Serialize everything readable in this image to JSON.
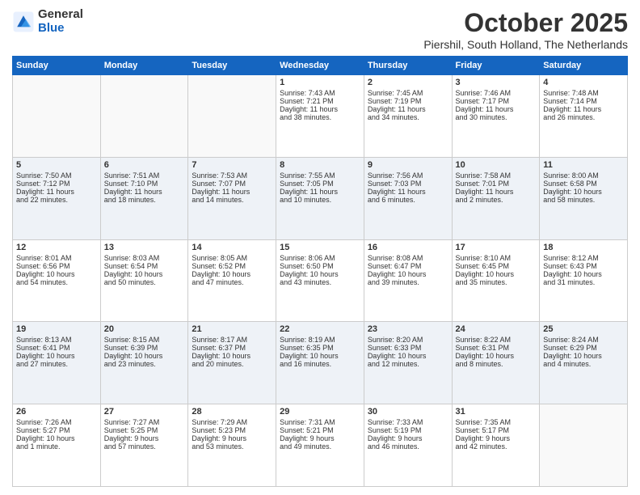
{
  "logo": {
    "general": "General",
    "blue": "Blue"
  },
  "header": {
    "month": "October 2025",
    "location": "Piershil, South Holland, The Netherlands"
  },
  "weekdays": [
    "Sunday",
    "Monday",
    "Tuesday",
    "Wednesday",
    "Thursday",
    "Friday",
    "Saturday"
  ],
  "weeks": [
    [
      {
        "day": "",
        "info": ""
      },
      {
        "day": "",
        "info": ""
      },
      {
        "day": "",
        "info": ""
      },
      {
        "day": "1",
        "info": "Sunrise: 7:43 AM\nSunset: 7:21 PM\nDaylight: 11 hours\nand 38 minutes."
      },
      {
        "day": "2",
        "info": "Sunrise: 7:45 AM\nSunset: 7:19 PM\nDaylight: 11 hours\nand 34 minutes."
      },
      {
        "day": "3",
        "info": "Sunrise: 7:46 AM\nSunset: 7:17 PM\nDaylight: 11 hours\nand 30 minutes."
      },
      {
        "day": "4",
        "info": "Sunrise: 7:48 AM\nSunset: 7:14 PM\nDaylight: 11 hours\nand 26 minutes."
      }
    ],
    [
      {
        "day": "5",
        "info": "Sunrise: 7:50 AM\nSunset: 7:12 PM\nDaylight: 11 hours\nand 22 minutes."
      },
      {
        "day": "6",
        "info": "Sunrise: 7:51 AM\nSunset: 7:10 PM\nDaylight: 11 hours\nand 18 minutes."
      },
      {
        "day": "7",
        "info": "Sunrise: 7:53 AM\nSunset: 7:07 PM\nDaylight: 11 hours\nand 14 minutes."
      },
      {
        "day": "8",
        "info": "Sunrise: 7:55 AM\nSunset: 7:05 PM\nDaylight: 11 hours\nand 10 minutes."
      },
      {
        "day": "9",
        "info": "Sunrise: 7:56 AM\nSunset: 7:03 PM\nDaylight: 11 hours\nand 6 minutes."
      },
      {
        "day": "10",
        "info": "Sunrise: 7:58 AM\nSunset: 7:01 PM\nDaylight: 11 hours\nand 2 minutes."
      },
      {
        "day": "11",
        "info": "Sunrise: 8:00 AM\nSunset: 6:58 PM\nDaylight: 10 hours\nand 58 minutes."
      }
    ],
    [
      {
        "day": "12",
        "info": "Sunrise: 8:01 AM\nSunset: 6:56 PM\nDaylight: 10 hours\nand 54 minutes."
      },
      {
        "day": "13",
        "info": "Sunrise: 8:03 AM\nSunset: 6:54 PM\nDaylight: 10 hours\nand 50 minutes."
      },
      {
        "day": "14",
        "info": "Sunrise: 8:05 AM\nSunset: 6:52 PM\nDaylight: 10 hours\nand 47 minutes."
      },
      {
        "day": "15",
        "info": "Sunrise: 8:06 AM\nSunset: 6:50 PM\nDaylight: 10 hours\nand 43 minutes."
      },
      {
        "day": "16",
        "info": "Sunrise: 8:08 AM\nSunset: 6:47 PM\nDaylight: 10 hours\nand 39 minutes."
      },
      {
        "day": "17",
        "info": "Sunrise: 8:10 AM\nSunset: 6:45 PM\nDaylight: 10 hours\nand 35 minutes."
      },
      {
        "day": "18",
        "info": "Sunrise: 8:12 AM\nSunset: 6:43 PM\nDaylight: 10 hours\nand 31 minutes."
      }
    ],
    [
      {
        "day": "19",
        "info": "Sunrise: 8:13 AM\nSunset: 6:41 PM\nDaylight: 10 hours\nand 27 minutes."
      },
      {
        "day": "20",
        "info": "Sunrise: 8:15 AM\nSunset: 6:39 PM\nDaylight: 10 hours\nand 23 minutes."
      },
      {
        "day": "21",
        "info": "Sunrise: 8:17 AM\nSunset: 6:37 PM\nDaylight: 10 hours\nand 20 minutes."
      },
      {
        "day": "22",
        "info": "Sunrise: 8:19 AM\nSunset: 6:35 PM\nDaylight: 10 hours\nand 16 minutes."
      },
      {
        "day": "23",
        "info": "Sunrise: 8:20 AM\nSunset: 6:33 PM\nDaylight: 10 hours\nand 12 minutes."
      },
      {
        "day": "24",
        "info": "Sunrise: 8:22 AM\nSunset: 6:31 PM\nDaylight: 10 hours\nand 8 minutes."
      },
      {
        "day": "25",
        "info": "Sunrise: 8:24 AM\nSunset: 6:29 PM\nDaylight: 10 hours\nand 4 minutes."
      }
    ],
    [
      {
        "day": "26",
        "info": "Sunrise: 7:26 AM\nSunset: 5:27 PM\nDaylight: 10 hours\nand 1 minute."
      },
      {
        "day": "27",
        "info": "Sunrise: 7:27 AM\nSunset: 5:25 PM\nDaylight: 9 hours\nand 57 minutes."
      },
      {
        "day": "28",
        "info": "Sunrise: 7:29 AM\nSunset: 5:23 PM\nDaylight: 9 hours\nand 53 minutes."
      },
      {
        "day": "29",
        "info": "Sunrise: 7:31 AM\nSunset: 5:21 PM\nDaylight: 9 hours\nand 49 minutes."
      },
      {
        "day": "30",
        "info": "Sunrise: 7:33 AM\nSunset: 5:19 PM\nDaylight: 9 hours\nand 46 minutes."
      },
      {
        "day": "31",
        "info": "Sunrise: 7:35 AM\nSunset: 5:17 PM\nDaylight: 9 hours\nand 42 minutes."
      },
      {
        "day": "",
        "info": ""
      }
    ]
  ]
}
